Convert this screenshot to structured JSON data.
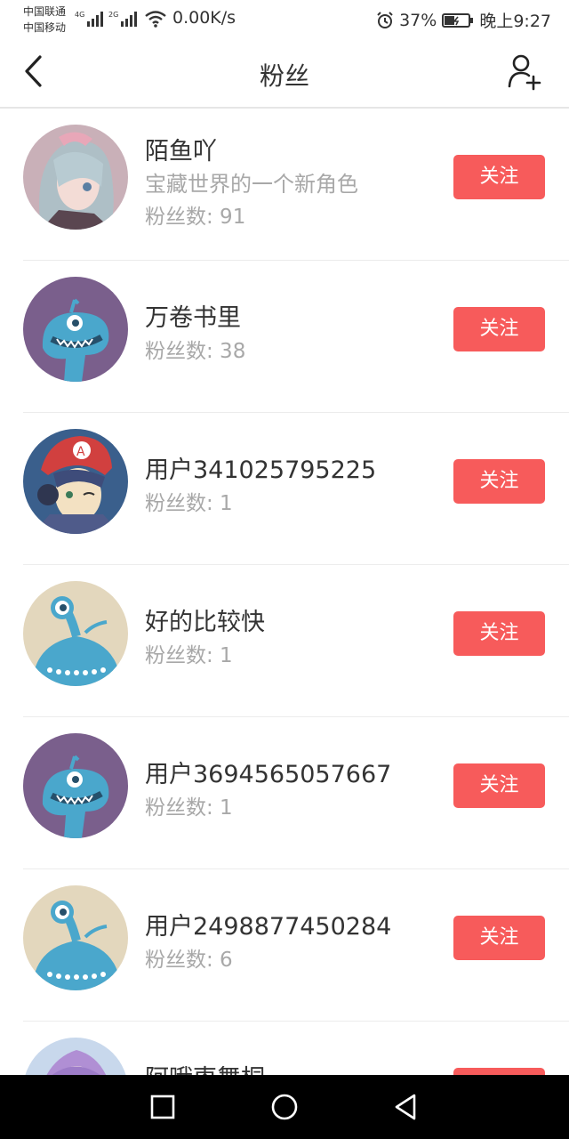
{
  "status_bar": {
    "carrier1": "中国联通",
    "carrier2": "中国移动",
    "net1": "4G",
    "net2": "2G",
    "speed": "0.00K/s",
    "battery": "37%",
    "time": "晚上9:27"
  },
  "header": {
    "title": "粉丝"
  },
  "colors": {
    "accent": "#f75b5b",
    "avatar_purple": "#7a5f8c",
    "avatar_beige": "#e3d7bd",
    "monster_blue": "#4aa7cc"
  },
  "fans": [
    {
      "name": "陌鱼吖",
      "signature": "宝藏世界的一个新角色",
      "fans": "粉丝数: 91",
      "button": "关注",
      "avatar": "anime-girl-avatar"
    },
    {
      "name": "万卷书里",
      "signature": "",
      "fans": "粉丝数: 38",
      "button": "关注",
      "avatar": "monster-purple-avatar"
    },
    {
      "name": "用户341025795225",
      "signature": "",
      "fans": "粉丝数: 1",
      "button": "关注",
      "avatar": "anime-boy-avatar"
    },
    {
      "name": "好的比较快",
      "signature": "",
      "fans": "粉丝数: 1",
      "button": "关注",
      "avatar": "monster-beige-avatar"
    },
    {
      "name": "用户3694565057667",
      "signature": "",
      "fans": "粉丝数: 1",
      "button": "关注",
      "avatar": "monster-purple-avatar"
    },
    {
      "name": "用户2498877450284",
      "signature": "",
      "fans": "粉丝数: 6",
      "button": "关注",
      "avatar": "monster-beige-avatar"
    },
    {
      "name": "阿哦枣舞桐",
      "signature": "",
      "fans": "",
      "button": "关注",
      "avatar": "anime-girl-avatar"
    }
  ]
}
